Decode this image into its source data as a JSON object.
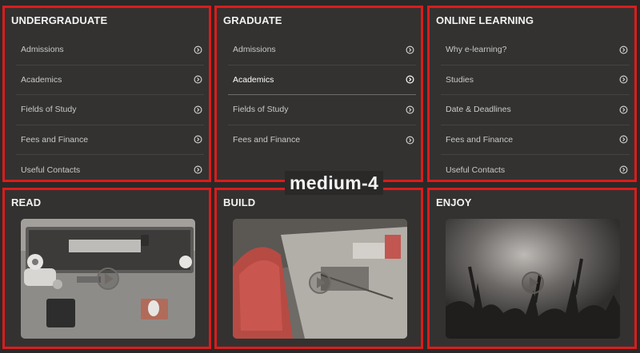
{
  "label": "medium-4",
  "panels": {
    "undergraduate": {
      "title": "UNDERGRADUATE",
      "items": [
        "Admissions",
        "Academics",
        "Fields of Study",
        "Fees and Finance",
        "Useful Contacts"
      ]
    },
    "graduate": {
      "title": "GRADUATE",
      "items": [
        "Admissions",
        "Academics",
        "Fields of Study",
        "Fees and Finance"
      ],
      "active_item": "Academics"
    },
    "online": {
      "title": "ONLINE LEARNING",
      "items": [
        "Why e-learning?",
        "Studies",
        "Date & Deadlines",
        "Fees and Finance",
        "Useful Contacts"
      ]
    },
    "read": {
      "title": "READ"
    },
    "build": {
      "title": "BUILD"
    },
    "enjoy": {
      "title": "ENJOY"
    }
  },
  "colors": {
    "outline": "#d91d1d",
    "panel_bg": "#333231",
    "page_bg": "#2a2928"
  },
  "icons": {
    "menu_arrow": "chevron-right-circle-icon",
    "video": "play-circle-icon"
  }
}
